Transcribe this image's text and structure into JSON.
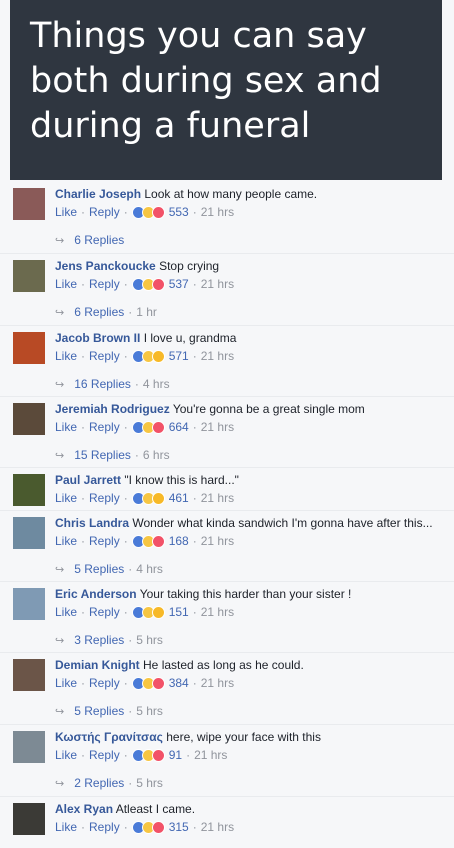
{
  "header": {
    "lines": [
      "Things you can say",
      "both during sex and",
      "during a funeral"
    ]
  },
  "colors": {
    "header_bg": "#2f3640",
    "name_blue": "#365899",
    "link_blue": "#4267b2",
    "meta_gray": "#90949c"
  },
  "actions": {
    "like": "Like",
    "reply": "Reply"
  },
  "comments": [
    {
      "name": "Charlie Joseph",
      "text": "Look at how many people came.",
      "reactions": [
        "like",
        "haha",
        "love"
      ],
      "count": "553",
      "time": "21 hrs",
      "replies": "6 Replies",
      "reply_time": "",
      "avatar": "#8a5a58"
    },
    {
      "name": "Jens Panckoucke",
      "text": "Stop crying",
      "reactions": [
        "like",
        "haha",
        "love"
      ],
      "count": "537",
      "time": "21 hrs",
      "replies": "6 Replies",
      "reply_time": "1 hr",
      "avatar": "#6b6a4e"
    },
    {
      "name": "Jacob Brown II",
      "text": "I love u, grandma",
      "reactions": [
        "like",
        "haha",
        "wow"
      ],
      "count": "571",
      "time": "21 hrs",
      "replies": "16 Replies",
      "reply_time": "4 hrs",
      "avatar": "#b84a25"
    },
    {
      "name": "Jeremiah Rodriguez",
      "text": "You're gonna be a great single mom",
      "reactions": [
        "like",
        "haha",
        "love"
      ],
      "count": "664",
      "time": "21 hrs",
      "replies": "15 Replies",
      "reply_time": "6 hrs",
      "avatar": "#5b4a3a"
    },
    {
      "name": "Paul Jarrett",
      "text": "\"I know this is hard...\"",
      "reactions": [
        "like",
        "haha",
        "wow"
      ],
      "count": "461",
      "time": "21 hrs",
      "replies": "",
      "reply_time": "",
      "avatar": "#4a5a2e"
    },
    {
      "name": "Chris Landra",
      "text": "Wonder what kinda sandwich I'm gonna have after this...",
      "reactions": [
        "like",
        "haha",
        "love"
      ],
      "count": "168",
      "time": "21 hrs",
      "replies": "5 Replies",
      "reply_time": "4 hrs",
      "avatar": "#6e8aa0"
    },
    {
      "name": "Eric Anderson",
      "text": "Your taking this harder than your sister !",
      "reactions": [
        "like",
        "haha",
        "wow"
      ],
      "count": "151",
      "time": "21 hrs",
      "replies": "3 Replies",
      "reply_time": "5 hrs",
      "avatar": "#7f9ab4"
    },
    {
      "name": "Demian Knight",
      "text": "He lasted as long as he could.",
      "reactions": [
        "like",
        "haha",
        "love"
      ],
      "count": "384",
      "time": "21 hrs",
      "replies": "5 Replies",
      "reply_time": "5 hrs",
      "avatar": "#6b5548"
    },
    {
      "name": "Κωστής Γρανίτσας",
      "text": "here, wipe your face with this",
      "reactions": [
        "like",
        "haha",
        "love"
      ],
      "count": "91",
      "time": "21 hrs",
      "replies": "2 Replies",
      "reply_time": "5 hrs",
      "avatar": "#7d8a94"
    },
    {
      "name": "Alex Ryan",
      "text": "Atleast I came.",
      "reactions": [
        "like",
        "haha",
        "love"
      ],
      "count": "315",
      "time": "21 hrs",
      "replies": "",
      "reply_time": "",
      "avatar": "#3b3a36"
    }
  ]
}
